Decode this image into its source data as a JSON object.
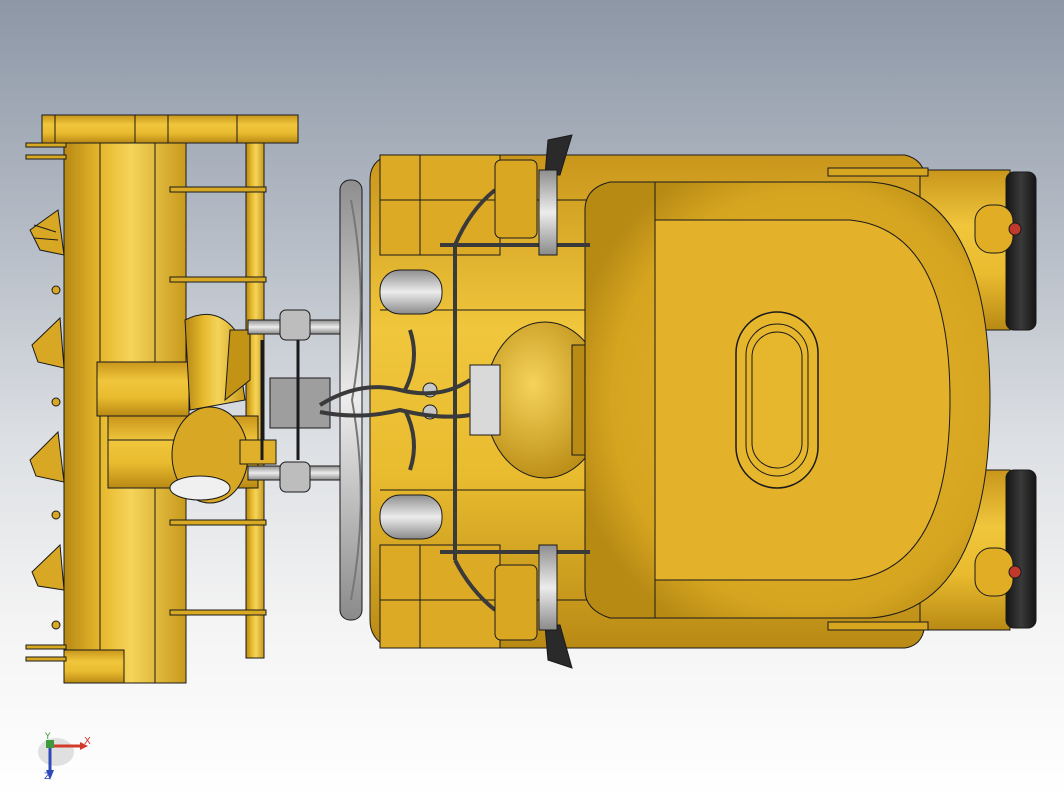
{
  "viewport": {
    "background_top": "#8d97a6",
    "background_bottom": "#ffffff"
  },
  "model": {
    "body_color": "#e3b42a",
    "body_shadow": "#b88a16",
    "body_highlight": "#f3cf4f",
    "edge_color": "#1a1a1a",
    "metal_color": "#cfcfcf",
    "hose_color": "#3a3a3a"
  },
  "triad": {
    "x_label": "X",
    "y_label": "Y",
    "z_label": "Z",
    "x_color": "#d23a2a",
    "y_color": "#3c9a3c",
    "z_color": "#3048b8"
  }
}
